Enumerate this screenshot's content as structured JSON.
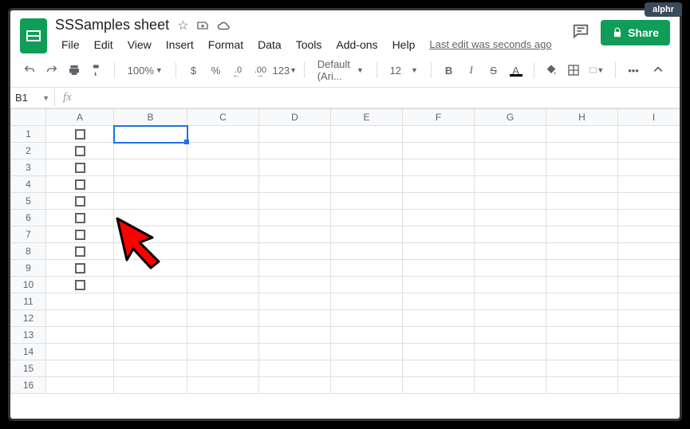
{
  "badge": "alphr",
  "doc_title": "SSSamples sheet",
  "menus": [
    "File",
    "Edit",
    "View",
    "Insert",
    "Format",
    "Data",
    "Tools",
    "Add-ons",
    "Help"
  ],
  "last_edit": "Last edit was seconds ago",
  "share_label": "Share",
  "toolbar": {
    "zoom": "100%",
    "currency": "$",
    "percent": "%",
    "dec_dec": ".0",
    "dec_inc": ".00",
    "more_fmt": "123",
    "font": "Default (Ari...",
    "size": "12",
    "bold": "B",
    "italic": "I",
    "strike": "S",
    "textcolor": "A",
    "more": "•••"
  },
  "name_box": "B1",
  "fx": "fx",
  "columns": [
    "A",
    "B",
    "C",
    "D",
    "E",
    "F",
    "G",
    "H",
    "I"
  ],
  "rows": [
    1,
    2,
    3,
    4,
    5,
    6,
    7,
    8,
    9,
    10,
    11,
    12,
    13,
    14,
    15,
    16
  ],
  "selected_cell": "B1",
  "selected_col": "B",
  "checkbox_rows": [
    1,
    2,
    3,
    4,
    5,
    6,
    7,
    8,
    9,
    10
  ]
}
